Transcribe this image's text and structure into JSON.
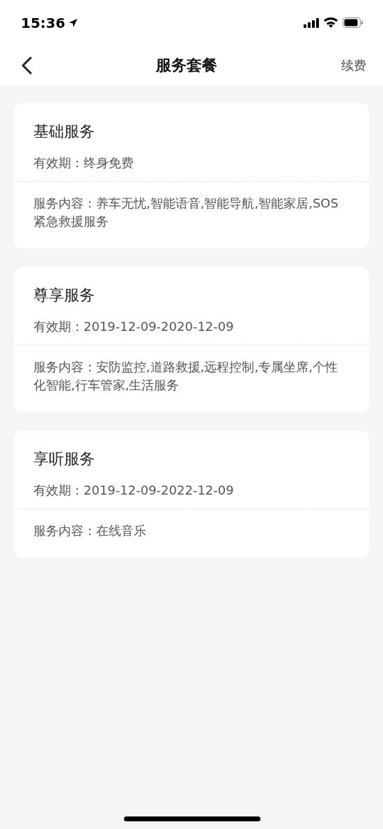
{
  "status_bar": {
    "time": "15:36"
  },
  "nav": {
    "title": "服务套餐",
    "action": "续费"
  },
  "cards": [
    {
      "title": "基础服务",
      "validity": "有效期：终身免费",
      "content": "服务内容：养车无忧,智能语音,智能导航,智能家居,SOS紧急救援服务"
    },
    {
      "title": "尊享服务",
      "validity": "有效期：2019-12-09-2020-12-09",
      "content": "服务内容：安防监控,道路救援,远程控制,专属坐席,个性化智能,行车管家,生活服务"
    },
    {
      "title": "享听服务",
      "validity": "有效期：2019-12-09-2022-12-09",
      "content": "服务内容：在线音乐"
    }
  ]
}
